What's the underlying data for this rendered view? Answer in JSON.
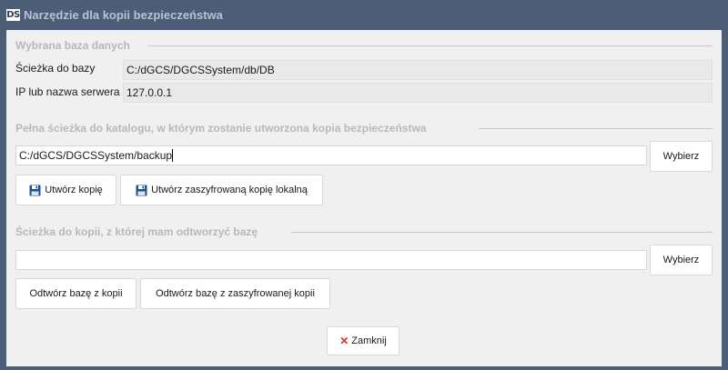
{
  "window": {
    "logo_text": "DS",
    "title": "Narzędzie dla kopii bezpieczeństwa"
  },
  "selected_db": {
    "section_title": "Wybrana baza danych",
    "path_label": "Ścieżka do bazy",
    "path_value": "C:/dGCS/DGCSSystem/db/DB",
    "server_label": "IP lub nazwa serwera",
    "server_value": "127.0.0.1"
  },
  "backup": {
    "section_title": "Pełna ścieżka do katalogu, w którym zostanie utworzona kopia bezpieczeństwa",
    "path_value": "C:/dGCS/DGCSSystem/backup",
    "browse_label": "Wybierz",
    "create_label": "Utwórz kopię",
    "create_encrypted_label": "Utwórz zaszyfrowaną kopię lokalną"
  },
  "restore": {
    "section_title": "Ścieżka do kopii, z której mam odtworzyć bazę",
    "path_value": "",
    "browse_label": "Wybierz",
    "restore_label": "Odtwórz bazę z kopii",
    "restore_encrypted_label": "Odtwórz bazę z zaszyfrowanej kopii"
  },
  "footer": {
    "close_label": "Zamknij"
  },
  "colors": {
    "titlebar": "#4b5d77",
    "panel": "#f0f0f0",
    "section_title": "#b8b8b8",
    "close_icon": "#d9342b",
    "floppy_icon": "#1f4e8c"
  },
  "icons": {
    "save": "floppy-disk-icon",
    "close": "close-icon"
  }
}
